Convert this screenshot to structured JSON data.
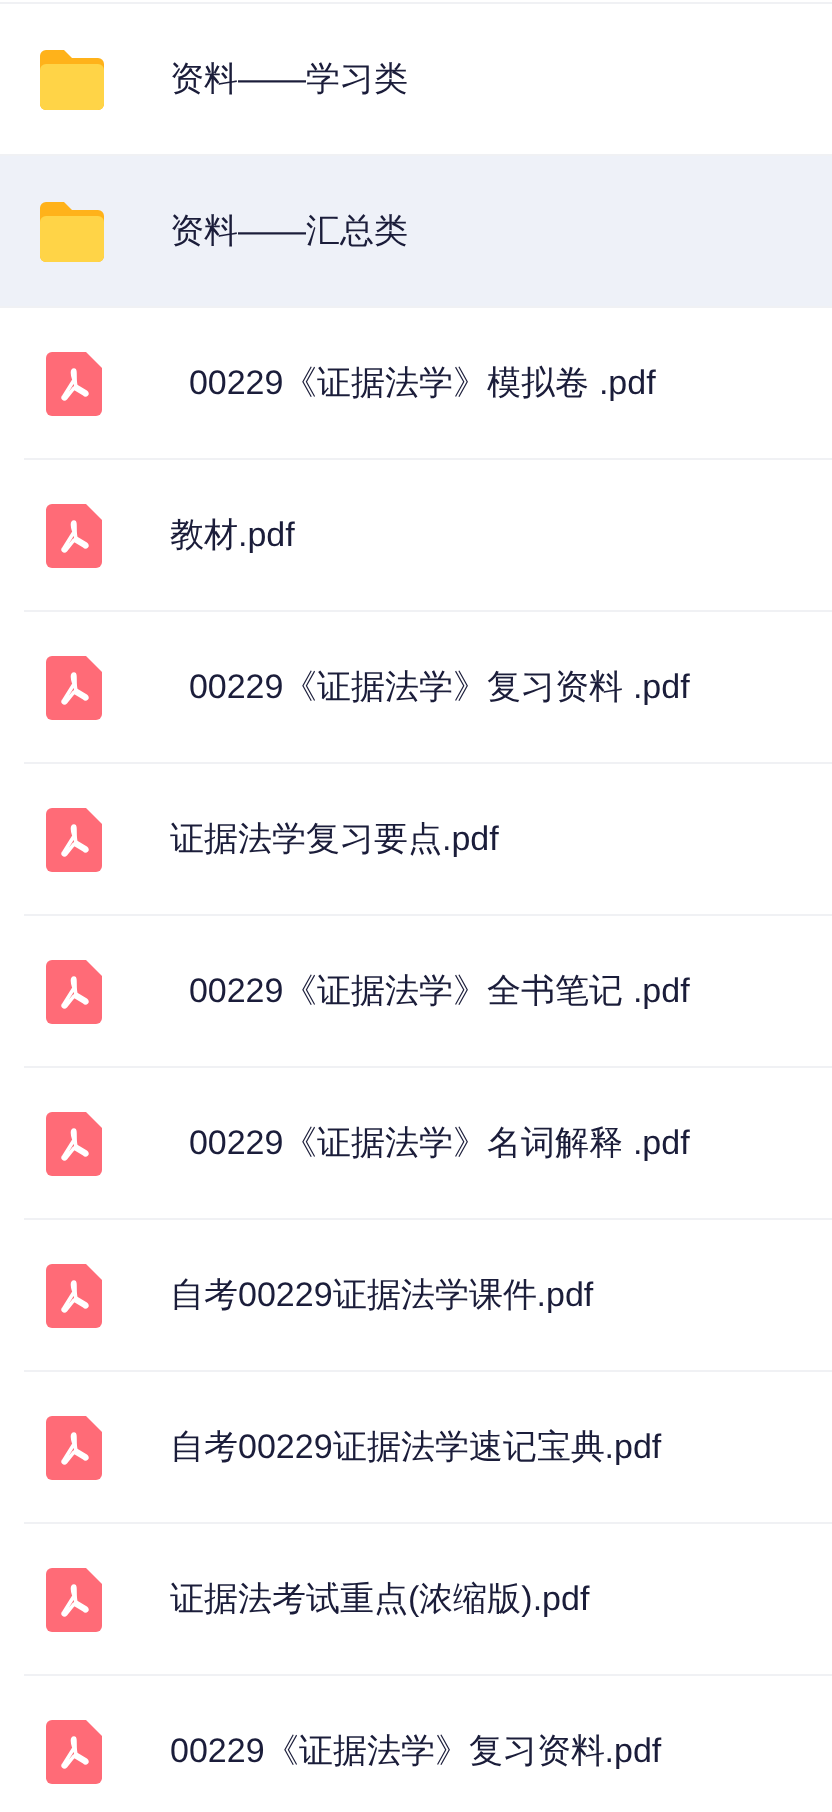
{
  "files": [
    {
      "kind": "folder",
      "name": "资料——学习类",
      "selected": false
    },
    {
      "kind": "folder",
      "name": "资料——汇总类",
      "selected": true
    },
    {
      "kind": "pdf",
      "name": "  00229《证据法学》模拟卷 .pdf",
      "selected": false
    },
    {
      "kind": "pdf",
      "name": "教材.pdf",
      "selected": false
    },
    {
      "kind": "pdf",
      "name": "  00229《证据法学》复习资料 .pdf",
      "selected": false
    },
    {
      "kind": "pdf",
      "name": "证据法学复习要点.pdf",
      "selected": false
    },
    {
      "kind": "pdf",
      "name": "  00229《证据法学》全书笔记 .pdf",
      "selected": false
    },
    {
      "kind": "pdf",
      "name": "  00229《证据法学》名词解释 .pdf",
      "selected": false
    },
    {
      "kind": "pdf",
      "name": "自考00229证据法学课件.pdf",
      "selected": false
    },
    {
      "kind": "pdf",
      "name": "自考00229证据法学速记宝典.pdf",
      "selected": false
    },
    {
      "kind": "pdf",
      "name": "证据法考试重点(浓缩版).pdf",
      "selected": false
    },
    {
      "kind": "pdf",
      "name": "00229《证据法学》复习资料.pdf",
      "selected": false
    }
  ]
}
